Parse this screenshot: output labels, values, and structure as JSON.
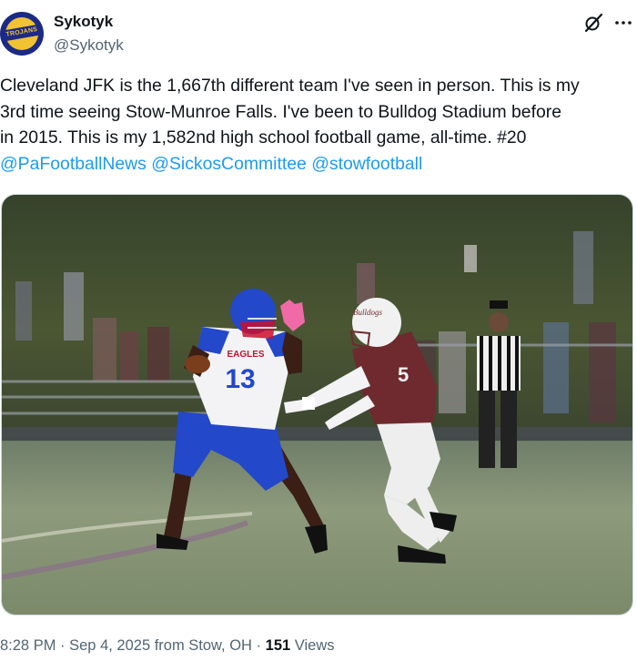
{
  "author": {
    "display_name": "Sykotyk",
    "handle": "@Sykotyk",
    "avatar_text": "TROJANS"
  },
  "icons": {
    "grok": "grok-icon",
    "more": "more-options-icon"
  },
  "tweet": {
    "line1": "Cleveland JFK is the 1,667th different team I've seen in person. This is my",
    "line2": "3rd time seeing Stow-Munroe Falls. I've been to Bulldog Stadium before",
    "line3": "in 2015. This is my 1,582nd high school football game, all-time. #20",
    "mentions": [
      "@PaFootballNews",
      "@SickosCommittee",
      "@stowfootball"
    ]
  },
  "media": {
    "jersey_number": "13",
    "jersey_word": "EAGLES",
    "helmet_word": "Bulldogs"
  },
  "meta": {
    "time": "8:28 PM",
    "sep1": " · ",
    "date": "Sep 4, 2025 from Stow, OH",
    "sep2": " · ",
    "views_count": "151",
    "views_label": " Views"
  },
  "colors": {
    "link": "#1d9bf0",
    "secondary_text": "#536471",
    "eagles_blue": "#2348c9",
    "bulldogs_maroon": "#6e2a2e"
  }
}
